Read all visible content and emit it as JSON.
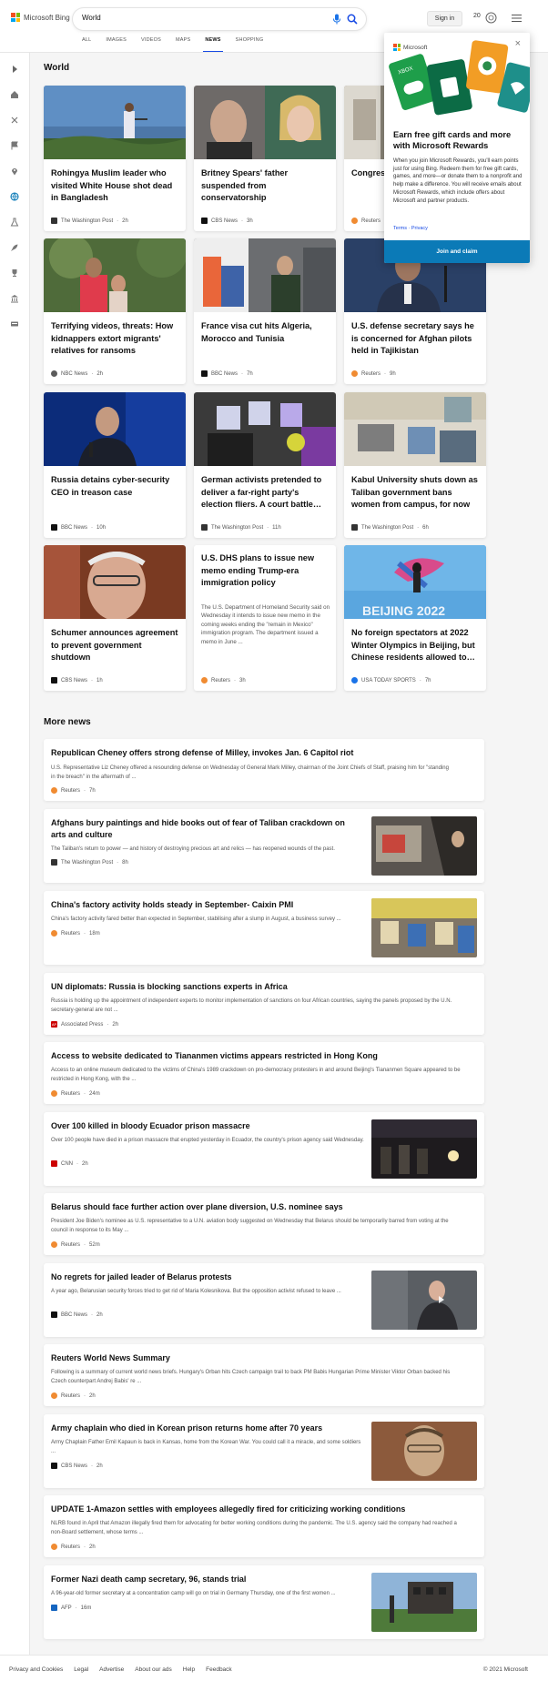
{
  "header": {
    "logo_text": "Microsoft Bing",
    "search_query": "World",
    "signin_label": "Sign in",
    "points": "20"
  },
  "tabs": [
    "ALL",
    "IMAGES",
    "VIDEOS",
    "MAPS",
    "NEWS",
    "SHOPPING"
  ],
  "active_tab": "NEWS",
  "section_world": "World",
  "cards": [
    {
      "title": "Rohingya Muslim leader who visited White House shot dead in Bangladesh",
      "source": "The Washington Post",
      "time": "2h",
      "src_color": "#333"
    },
    {
      "title": "Britney Spears' father suspended from conservatorship",
      "source": "CBS News",
      "time": "3h",
      "src_color": "#111"
    },
    {
      "title": "Congress U.S. Cap subpoen",
      "source": "Reuters",
      "time": "",
      "src_color": "#f08b32"
    },
    {
      "title": "Terrifying videos, threats: How kidnappers extort migrants' relatives for ransoms",
      "source": "NBC News",
      "time": "2h",
      "src_color": "#5b5b5b"
    },
    {
      "title": "France visa cut hits Algeria, Morocco and Tunisia",
      "source": "BBC News",
      "time": "7h",
      "src_color": "#111"
    },
    {
      "title": "U.S. defense secretary says he is concerned for Afghan pilots held in Tajikistan",
      "source": "Reuters",
      "time": "9h",
      "src_color": "#f08b32"
    },
    {
      "title": "Russia detains cyber-security CEO in treason case",
      "source": "BBC News",
      "time": "10h",
      "src_color": "#111"
    },
    {
      "title": "German activists pretended to deliver a far-right party's election fliers. A court battle…",
      "source": "The Washington Post",
      "time": "11h",
      "src_color": "#333"
    },
    {
      "title": "Kabul University shuts down as Taliban government bans women from campus, for now",
      "source": "The Washington Post",
      "time": "6h",
      "src_color": "#333"
    },
    {
      "title": "Schumer announces agreement to prevent government shutdown",
      "source": "CBS News",
      "time": "1h",
      "src_color": "#111"
    },
    {
      "title": "U.S. DHS plans to issue new memo ending Trump-era immigration policy",
      "snippet": "The U.S. Department of Homeland Security said on Wednesday it intends to issue new memo in the coming weeks ending the \"remain in Mexico\" immigration program. The department issued a memo in June ...",
      "source": "Reuters",
      "time": "3h",
      "src_color": "#f08b32"
    },
    {
      "title": "No foreign spectators at 2022 Winter Olympics in Beijing, but Chinese residents allowed to…",
      "source": "USA TODAY SPORTS",
      "time": "7h",
      "src_color": "#1a73e8",
      "image_text": "BEIJING 2022"
    }
  ],
  "section_more": "More news",
  "more_news": [
    {
      "title": "Republican Cheney offers strong defense of Milley, invokes Jan. 6 Capitol riot",
      "snippet": "U.S. Representative Liz Cheney offered a resounding defense on Wednesday of General Mark Milley, chairman of the Joint Chiefs of Staff, praising him for \"standing in the breach\" in the aftermath of ...",
      "source": "Reuters",
      "time": "7h",
      "src_color": "#f08b32"
    },
    {
      "title": "Afghans bury paintings and hide books out of fear of Taliban crackdown on arts and culture",
      "snippet": "The Taliban's return to power — and history of destroying precious art and relics — has reopened wounds of the past.",
      "source": "The Washington Post",
      "time": "8h",
      "src_color": "#333"
    },
    {
      "title": "China's factory activity holds steady in September- Caixin PMI",
      "snippet": "China's factory activity fared better than expected in September, stabilising after a slump in August, a business survey ...",
      "source": "Reuters",
      "time": "18m",
      "src_color": "#f08b32"
    },
    {
      "title": "UN diplomats: Russia is blocking sanctions experts in Africa",
      "snippet": "Russia is holding up the appointment of independent experts to monitor implementation of sanctions on four African countries, saying the panels proposed by the U.N. secretary-general are not ...",
      "source": "Associated Press",
      "time": "2h",
      "src_color": "#c00",
      "src_badge": "AP"
    },
    {
      "title": "Access to website dedicated to Tiananmen victims appears restricted in Hong Kong",
      "snippet": "Access to an online museum dedicated to the victims of China's 1989 crackdown on pro-democracy protesters in and around Beijing's Tiananmen Square appeared to be restricted in Hong Kong, with the ...",
      "source": "Reuters",
      "time": "24m",
      "src_color": "#f08b32"
    },
    {
      "title": "Over 100 killed in bloody Ecuador prison massacre",
      "snippet": "Over 100 people have died in a prison massacre that erupted yesterday in Ecuador, the country's prison agency said Wednesday.",
      "source": "CNN",
      "time": "2h",
      "src_color": "#cc0000"
    },
    {
      "title": "Belarus should face further action over plane diversion, U.S. nominee says",
      "snippet": "President Joe Biden's nominee as U.S. representative to a U.N. aviation body suggested on Wednesday that Belarus should be temporarily barred from voting at the council in response to its May ...",
      "source": "Reuters",
      "time": "52m",
      "src_color": "#f08b32"
    },
    {
      "title": "No regrets for jailed leader of Belarus protests",
      "snippet": "A year ago, Belarusian security forces tried to get rid of Maria Kolesnikova. But the opposition activist refused to leave ...",
      "source": "BBC News",
      "time": "2h",
      "src_color": "#111"
    },
    {
      "title": "Reuters World News Summary",
      "snippet": "Following is a summary of current world news briefs. Hungary's Orban hits Czech campaign trail to back PM Babis Hungarian Prime Minister Viktor Orban backed his Czech counterpart Andrej Babis' re ...",
      "source": "Reuters",
      "time": "2h",
      "src_color": "#f08b32"
    },
    {
      "title": "Army chaplain who died in Korean prison returns home after 70 years",
      "snippet": "Army Chaplain Father Emil Kapaun is back in Kansas, home from the Korean War. You could call it a miracle, and some soldiers ...",
      "source": "CBS News",
      "time": "2h",
      "src_color": "#111"
    },
    {
      "title": "UPDATE 1-Amazon settles with employees allegedly fired for criticizing working conditions",
      "snippet": "NLRB found in April that Amazon illegally fired them for advocating for better working conditions during the pandemic. The U.S. agency said the company had reached a non-Board settlement, whose terms ...",
      "source": "Reuters",
      "time": "2h",
      "src_color": "#f08b32"
    },
    {
      "title": "Former Nazi death camp secretary, 96, stands trial",
      "snippet": "A 96-year-old former secretary at a concentration camp will go on trial in Germany Thursday, one of the first women ...",
      "source": "AFP",
      "time": "16m",
      "src_color": "#1565c0"
    }
  ],
  "flyout": {
    "brand": "Microsoft",
    "title": "Earn free gift cards and more with Microsoft Rewards",
    "body": "When you join Microsoft Rewards, you'll earn points just for using Bing. Redeem them for free gift cards, games, and more—or donate them to a nonprofit and help make a difference. You will receive emails about Microsoft Rewards, which include offers about Microsoft and partner products.",
    "terms": "Terms",
    "privacy": "Privacy",
    "button": "Join and claim",
    "close": "×",
    "card_text": "XBOX"
  },
  "footer": {
    "links": [
      "Privacy and Cookies",
      "Legal",
      "Advertise",
      "About our ads",
      "Help",
      "Feedback"
    ],
    "copyright": "© 2021 Microsoft"
  },
  "colors": {
    "accent": "#174ae4",
    "join_button": "#0b7ab7",
    "ms_red": "#f25022",
    "ms_green": "#7fba00",
    "ms_blue": "#00a4ef",
    "ms_yellow": "#ffb900"
  }
}
